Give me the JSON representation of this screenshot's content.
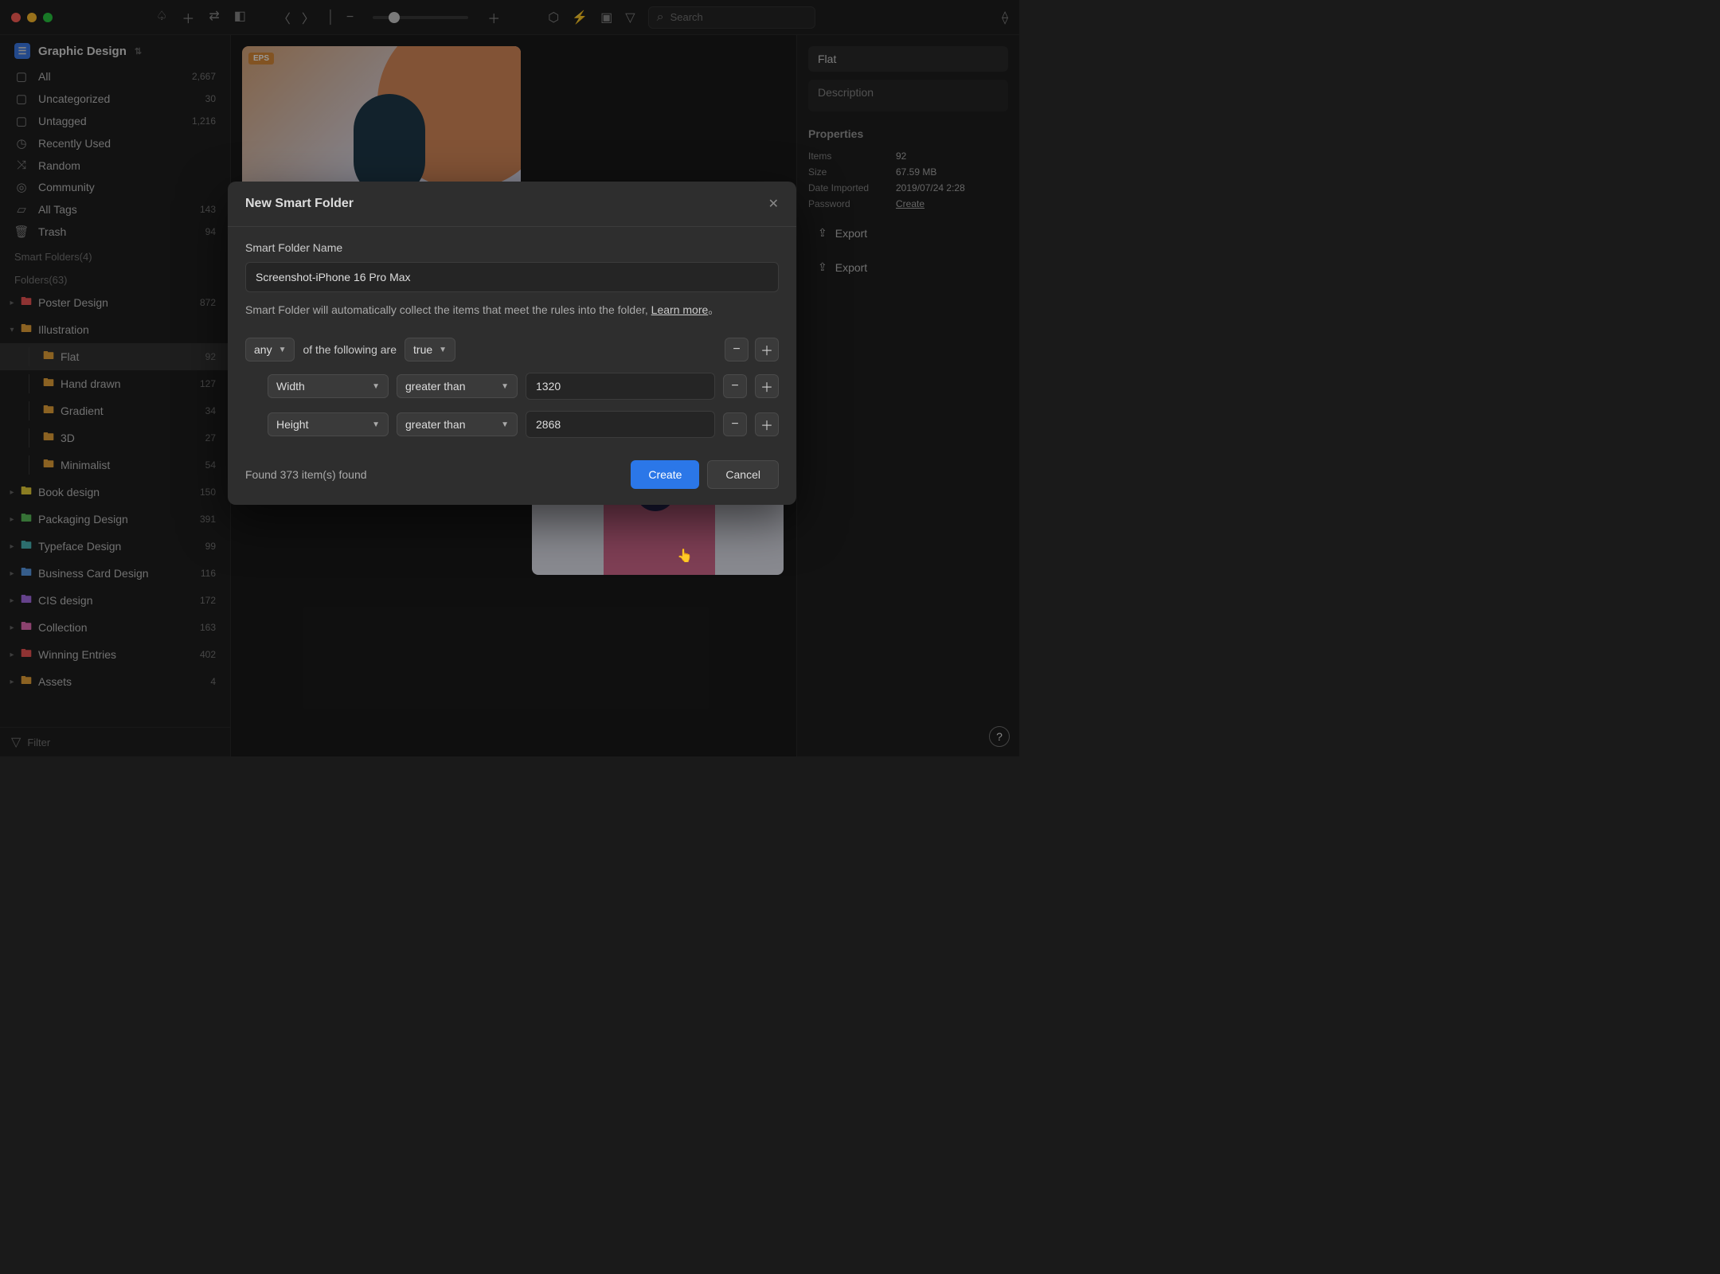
{
  "titlebar": {
    "search_placeholder": "Search"
  },
  "library": {
    "name": "Graphic Design"
  },
  "sidebar_main": [
    {
      "icon": "▢",
      "label": "All",
      "count": "2,667"
    },
    {
      "icon": "▢",
      "label": "Uncategorized",
      "count": "30"
    },
    {
      "icon": "▢",
      "label": "Untagged",
      "count": "1,216"
    },
    {
      "icon": "◷",
      "label": "Recently Used",
      "count": ""
    },
    {
      "icon": "⤨",
      "label": "Random",
      "count": ""
    },
    {
      "icon": "◎",
      "label": "Community",
      "count": ""
    },
    {
      "icon": "▱",
      "label": "All Tags",
      "count": "143"
    },
    {
      "icon": "🗑",
      "label": "Trash",
      "count": "94"
    }
  ],
  "sections": {
    "smart": "Smart Folders(4)",
    "folders": "Folders(63)"
  },
  "folders": [
    {
      "name": "Poster Design",
      "count": "872",
      "color": "fc-red",
      "expandable": true
    },
    {
      "name": "Illustration",
      "count": "",
      "color": "fc-orange",
      "expandable": true,
      "expanded": true,
      "children": [
        {
          "name": "Flat",
          "count": "92",
          "selected": true
        },
        {
          "name": "Hand drawn",
          "count": "127"
        },
        {
          "name": "Gradient",
          "count": "34"
        },
        {
          "name": "3D",
          "count": "27"
        },
        {
          "name": "Minimalist",
          "count": "54"
        }
      ]
    },
    {
      "name": "Book design",
      "count": "150",
      "color": "fc-yellow",
      "expandable": true
    },
    {
      "name": "Packaging Design",
      "count": "391",
      "color": "fc-green",
      "expandable": true
    },
    {
      "name": "Typeface Design",
      "count": "99",
      "color": "fc-teal",
      "expandable": true
    },
    {
      "name": "Business Card Design",
      "count": "116",
      "color": "fc-blue",
      "expandable": true
    },
    {
      "name": "CIS design",
      "count": "172",
      "color": "fc-purple",
      "expandable": true
    },
    {
      "name": "Collection",
      "count": "163",
      "color": "fc-pink",
      "expandable": true
    },
    {
      "name": "Winning Entries",
      "count": "402",
      "color": "fc-red",
      "expandable": true
    },
    {
      "name": "Assets",
      "count": "4",
      "color": "fc-orange",
      "expandable": true
    }
  ],
  "filter_placeholder": "Filter",
  "badge": "EPS",
  "inspector": {
    "title": "Flat",
    "description_placeholder": "Description",
    "section": "Properties",
    "props": [
      {
        "k": "Items",
        "v": "92"
      },
      {
        "k": "Size",
        "v": "67.59 MB"
      },
      {
        "k": "Date Imported",
        "v": "2019/07/24 2:28"
      },
      {
        "k": "Password",
        "v": "Create",
        "link": true
      }
    ],
    "export": "Export"
  },
  "modal": {
    "title": "New Smart Folder",
    "name_label": "Smart Folder Name",
    "name_value": "Screenshot-iPhone 16 Pro Max",
    "help_text": "Smart Folder will automatically collect the items that meet the rules into the folder, ",
    "learn_more": "Learn more",
    "help_suffix": "。",
    "rule_any_label": "any",
    "rule_of_label": "of the following are",
    "rule_true_label": "true",
    "rules": [
      {
        "field": "Width",
        "op": "greater than",
        "value": "1320"
      },
      {
        "field": "Height",
        "op": "greater than",
        "value": "2868"
      }
    ],
    "found": "Found 373 item(s) found",
    "create": "Create",
    "cancel": "Cancel"
  }
}
